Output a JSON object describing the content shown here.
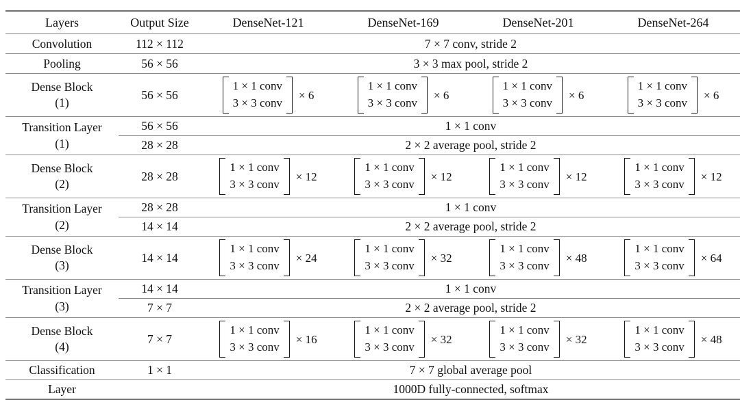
{
  "table": {
    "headers": [
      "Layers",
      "Output Size",
      "DenseNet-121",
      "DenseNet-169",
      "DenseNet-201",
      "DenseNet-264"
    ],
    "rows": {
      "convolution": {
        "layer": "Convolution",
        "output": "112 × 112",
        "spanned": "7 × 7 conv, stride 2"
      },
      "pooling": {
        "layer": "Pooling",
        "output": "56 × 56",
        "spanned": "3 × 3 max pool, stride 2"
      },
      "dense_block_1": {
        "layer_line1": "Dense Block",
        "layer_line2": "(1)",
        "output": "56 × 56",
        "conv_line1": "1 × 1 conv",
        "conv_line2": "3 × 3 conv",
        "multipliers": [
          "× 6",
          "× 6",
          "× 6",
          "× 6"
        ]
      },
      "transition_1": {
        "layer_line1": "Transition Layer",
        "layer_line2": "(1)",
        "output_a": "56 × 56",
        "output_b": "28 × 28",
        "spanned_a": "1 × 1 conv",
        "spanned_b": "2 × 2 average pool, stride 2"
      },
      "dense_block_2": {
        "layer_line1": "Dense Block",
        "layer_line2": "(2)",
        "output": "28 × 28",
        "conv_line1": "1 × 1 conv",
        "conv_line2": "3 × 3 conv",
        "multipliers": [
          "× 12",
          "× 12",
          "× 12",
          "× 12"
        ]
      },
      "transition_2": {
        "layer_line1": "Transition Layer",
        "layer_line2": "(2)",
        "output_a": "28 × 28",
        "output_b": "14 × 14",
        "spanned_a": "1 × 1 conv",
        "spanned_b": "2 × 2 average pool, stride 2"
      },
      "dense_block_3": {
        "layer_line1": "Dense Block",
        "layer_line2": "(3)",
        "output": "14 × 14",
        "conv_line1": "1 × 1 conv",
        "conv_line2": "3 × 3 conv",
        "multipliers": [
          "× 24",
          "× 32",
          "× 48",
          "× 64"
        ]
      },
      "transition_3": {
        "layer_line1": "Transition Layer",
        "layer_line2": "(3)",
        "output_a": "14 × 14",
        "output_b": "7 × 7",
        "spanned_a": "1 × 1 conv",
        "spanned_b": "2 × 2 average pool, stride 2"
      },
      "dense_block_4": {
        "layer_line1": "Dense Block",
        "layer_line2": "(4)",
        "output": "7 × 7",
        "conv_line1": "1 × 1 conv",
        "conv_line2": "3 × 3 conv",
        "multipliers": [
          "× 16",
          "× 32",
          "× 32",
          "× 48"
        ]
      },
      "classification": {
        "layer_line1": "Classification",
        "layer_line2": "Layer",
        "output_a": "1 × 1",
        "output_b": "",
        "spanned_a": "7 × 7 global average pool",
        "spanned_b": "1000D fully-connected, softmax"
      }
    }
  },
  "colors": {
    "rule": "#7d7d7d",
    "text": "#111111",
    "background": "#ffffff"
  }
}
